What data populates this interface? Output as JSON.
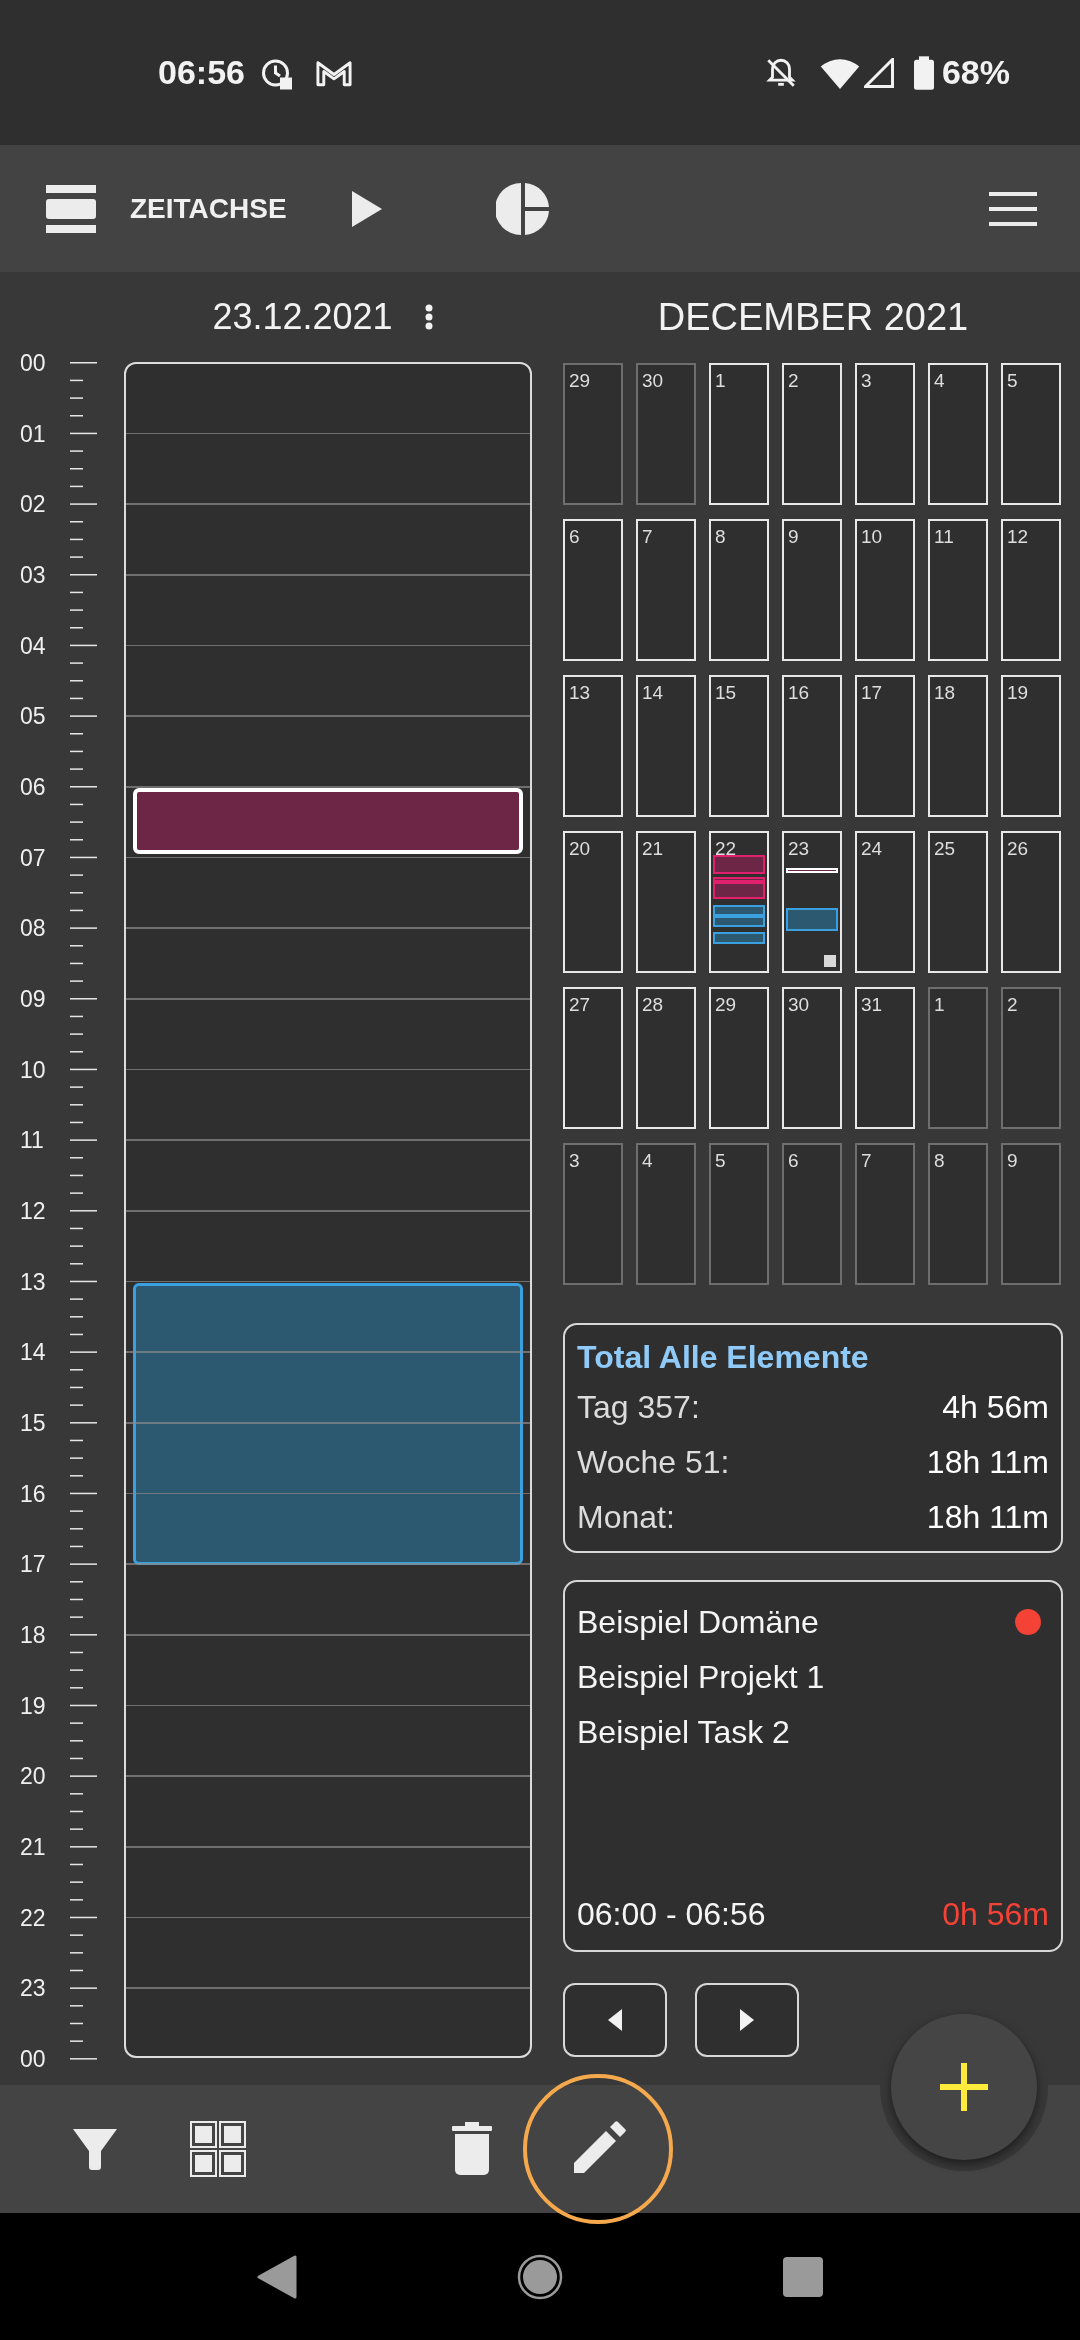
{
  "status_bar": {
    "time": "06:56",
    "battery": "68%"
  },
  "toolbar": {
    "title": "ZEITACHSE"
  },
  "day_view": {
    "date": "23.12.2021",
    "hours": [
      "00",
      "01",
      "02",
      "03",
      "04",
      "05",
      "06",
      "07",
      "08",
      "09",
      "10",
      "11",
      "12",
      "13",
      "14",
      "15",
      "16",
      "17",
      "18",
      "19",
      "20",
      "21",
      "22",
      "23",
      "00"
    ],
    "events": [
      {
        "color": "#6e2646",
        "selected": true
      },
      {
        "kind": "task",
        "color": "#2c5870",
        "selected": false
      }
    ]
  },
  "month": {
    "title": "DECEMBER 2021",
    "days": [
      {
        "label": "29",
        "in_month": false
      },
      {
        "label": "30",
        "in_month": false
      },
      {
        "label": "1",
        "in_month": true
      },
      {
        "label": "2",
        "in_month": true
      },
      {
        "label": "3",
        "in_month": true
      },
      {
        "label": "4",
        "in_month": true
      },
      {
        "label": "5",
        "in_month": true
      },
      {
        "label": "6",
        "in_month": true
      },
      {
        "label": "7",
        "in_month": true
      },
      {
        "label": "8",
        "in_month": true
      },
      {
        "label": "9",
        "in_month": true
      },
      {
        "label": "10",
        "in_month": true
      },
      {
        "label": "11",
        "in_month": true
      },
      {
        "label": "12",
        "in_month": true
      },
      {
        "label": "13",
        "in_month": true
      },
      {
        "label": "14",
        "in_month": true
      },
      {
        "label": "15",
        "in_month": true
      },
      {
        "label": "16",
        "in_month": true
      },
      {
        "label": "17",
        "in_month": true
      },
      {
        "label": "18",
        "in_month": true
      },
      {
        "label": "19",
        "in_month": true
      },
      {
        "label": "20",
        "in_month": true
      },
      {
        "label": "21",
        "in_month": true
      },
      {
        "label": "22",
        "in_month": true,
        "events": [
          {
            "kind": "project",
            "color": "#6e2646",
            "selected": false
          },
          {
            "kind": "project",
            "color": "#6e2646",
            "selected": false
          },
          {
            "kind": "project",
            "color": "#6e2646",
            "selected": false
          },
          {
            "kind": "task",
            "color": "#2c5870",
            "selected": false
          },
          {
            "kind": "task",
            "color": "#2c5870",
            "selected": false
          },
          {
            "kind": "task",
            "color": "#2c5870",
            "selected": false
          }
        ]
      },
      {
        "label": "23",
        "in_month": true,
        "today": true,
        "events": [
          {
            "color": "#6e2646",
            "selected": true
          },
          {
            "kind": "task",
            "color": "#2c5870",
            "selected": false
          }
        ]
      },
      {
        "label": "24",
        "in_month": true
      },
      {
        "label": "25",
        "in_month": true
      },
      {
        "label": "26",
        "in_month": true
      },
      {
        "label": "27",
        "in_month": true
      },
      {
        "label": "28",
        "in_month": true
      },
      {
        "label": "29",
        "in_month": true
      },
      {
        "label": "30",
        "in_month": true
      },
      {
        "label": "31",
        "in_month": true
      },
      {
        "label": "1",
        "in_month": false
      },
      {
        "label": "2",
        "in_month": false
      },
      {
        "label": "3",
        "in_month": false
      },
      {
        "label": "4",
        "in_month": false
      },
      {
        "label": "5",
        "in_month": false
      },
      {
        "label": "6",
        "in_month": false
      },
      {
        "label": "7",
        "in_month": false
      },
      {
        "label": "8",
        "in_month": false
      },
      {
        "label": "9",
        "in_month": false
      }
    ]
  },
  "totals": {
    "title": "Total Alle Elemente",
    "rows": [
      {
        "label": "Tag 357:",
        "value": "4h 56m"
      },
      {
        "label": "Woche 51:",
        "value": "18h 11m"
      },
      {
        "label": "Monat:",
        "value": "18h 11m"
      }
    ]
  },
  "entry": {
    "lines": [
      "Beispiel Domäne",
      "Beispiel Projekt 1",
      "Beispiel Task 2"
    ],
    "color": "#f44336",
    "time_range": "06:00 - 06:56",
    "duration": "0h 56m"
  },
  "bottom_bar": [
    {
      "kind": "filter",
      "highlighted": false
    },
    {
      "kind": "grid",
      "highlighted": false
    },
    {
      "kind": "delete",
      "highlighted": false
    },
    {
      "kind": "edit",
      "highlighted": true
    }
  ]
}
